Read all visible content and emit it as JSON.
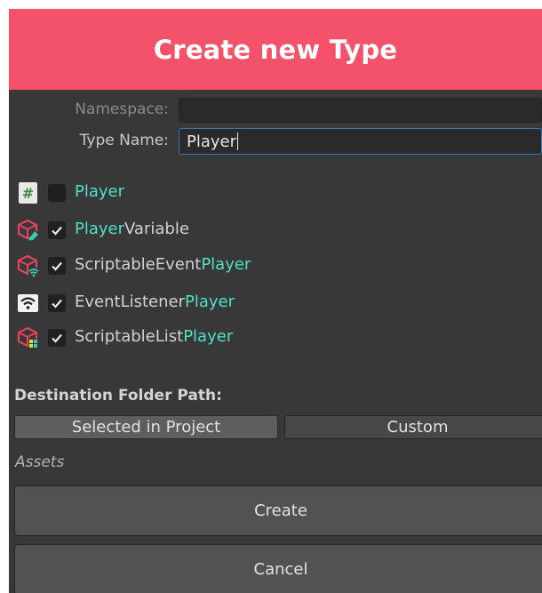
{
  "header": {
    "title": "Create new Type"
  },
  "form": {
    "namespace_label": "Namespace:",
    "namespace_value": "",
    "type_name_label": "Type Name:",
    "type_name_value": "Player"
  },
  "items": [
    {
      "icon": "csharp-script-icon",
      "checked": false,
      "prefix": "",
      "highlight": "Player",
      "suffix": ""
    },
    {
      "icon": "scriptable-variable-icon",
      "checked": true,
      "prefix": "",
      "highlight": "Player",
      "suffix": "Variable"
    },
    {
      "icon": "scriptable-event-icon",
      "checked": true,
      "prefix": "ScriptableEvent",
      "highlight": "Player",
      "suffix": ""
    },
    {
      "icon": "event-listener-icon",
      "checked": true,
      "prefix": "EventListener",
      "highlight": "Player",
      "suffix": ""
    },
    {
      "icon": "scriptable-list-icon",
      "checked": true,
      "prefix": "ScriptableList",
      "highlight": "Player",
      "suffix": ""
    }
  ],
  "destination": {
    "label": "Destination Folder Path:",
    "tab_selected": "Selected in Project",
    "tab_custom": "Custom",
    "path": "Assets"
  },
  "buttons": {
    "create": "Create",
    "cancel": "Cancel"
  },
  "colors": {
    "header": "#f4526a",
    "highlight": "#4fe0c6",
    "background": "#383838"
  }
}
